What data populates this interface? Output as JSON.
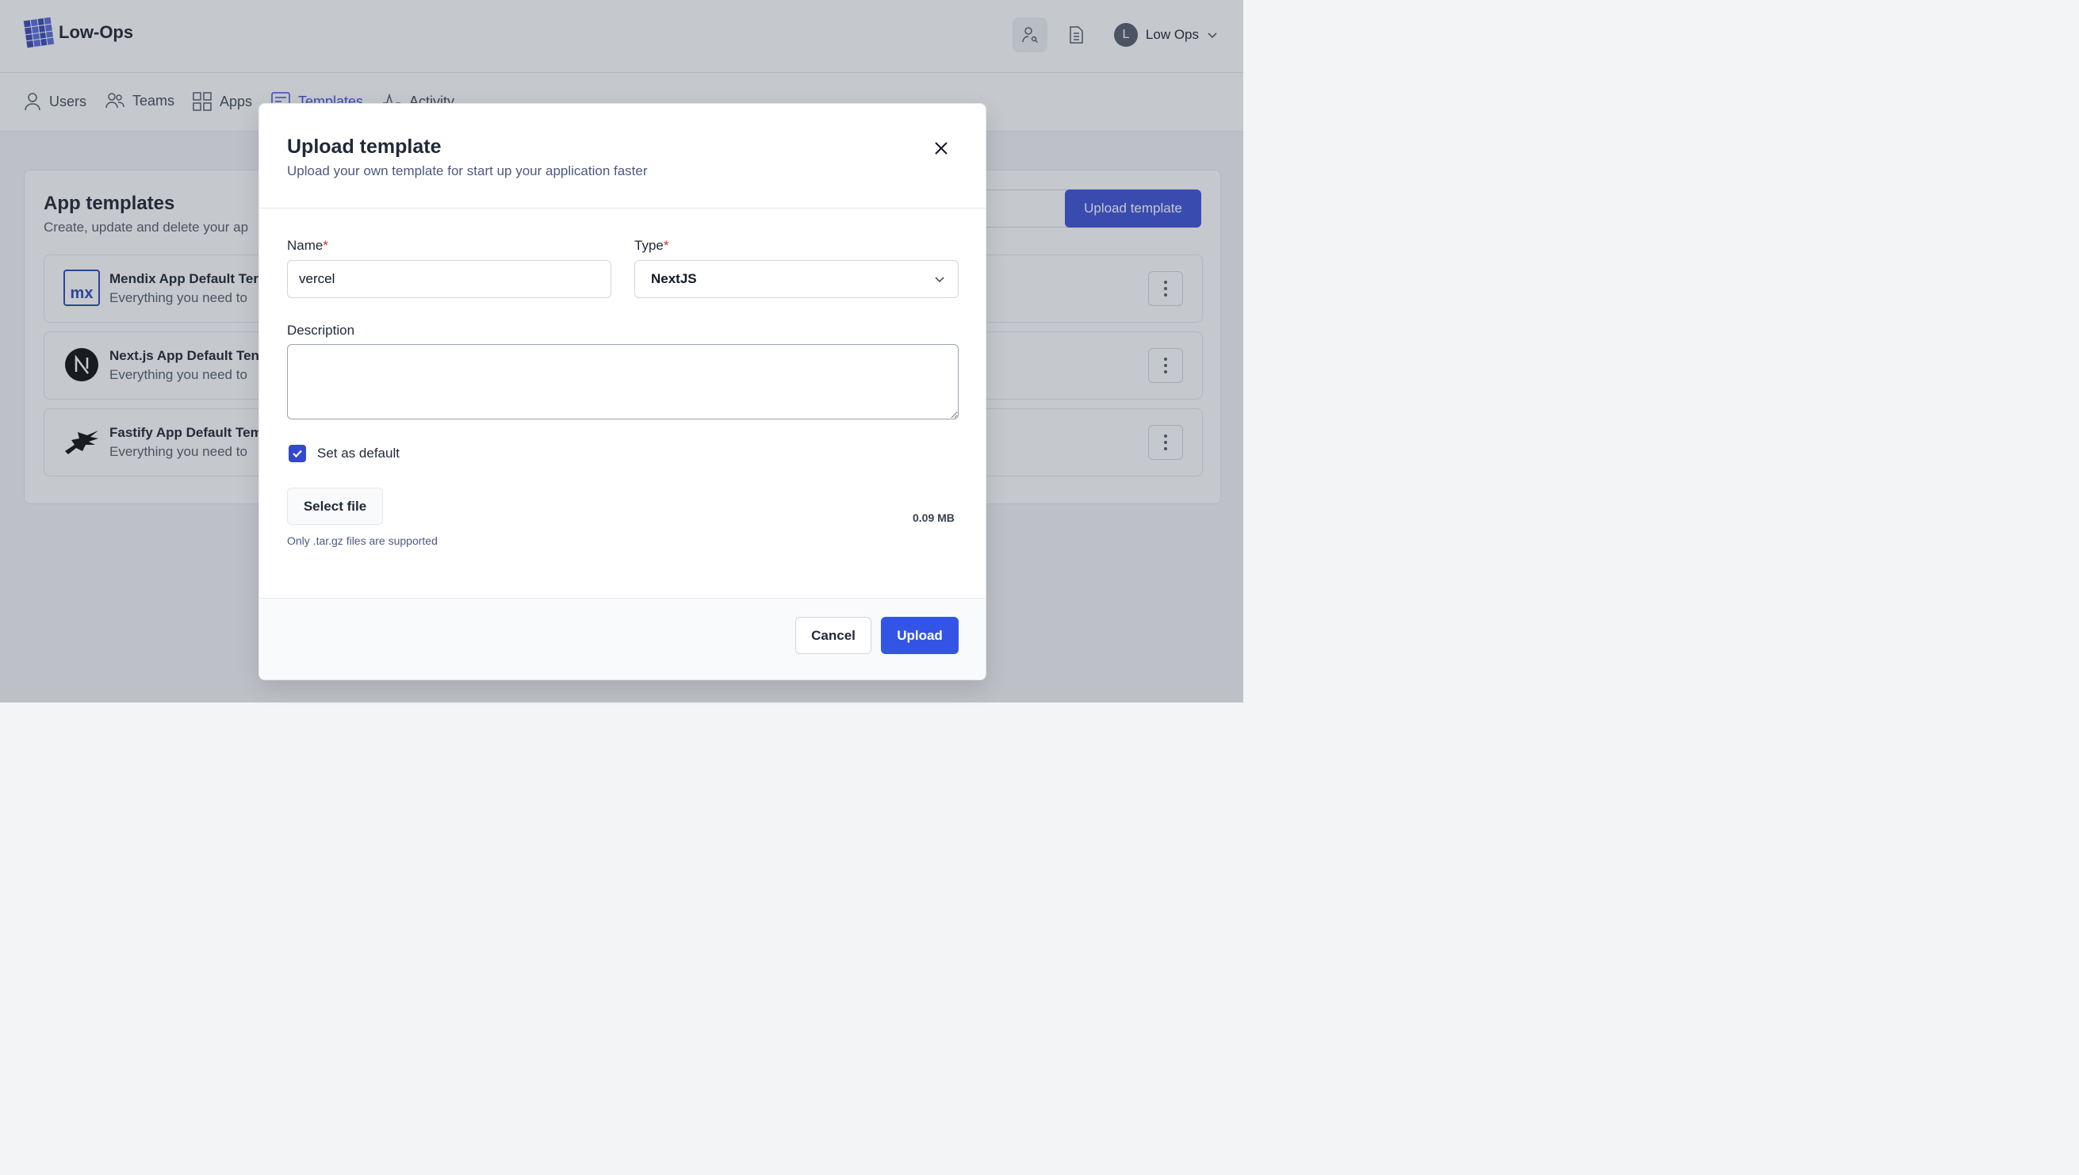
{
  "app": {
    "name": "Low-Ops"
  },
  "header": {
    "user_name": "Low Ops",
    "avatar_initial": "L",
    "icons": [
      "user-key-icon",
      "document-icon"
    ]
  },
  "nav": {
    "items": [
      {
        "label": "Users",
        "icon": "user-icon",
        "active": false
      },
      {
        "label": "Teams",
        "icon": "team-icon",
        "active": false
      },
      {
        "label": "Apps",
        "icon": "grid-icon",
        "active": false
      },
      {
        "label": "Templates",
        "icon": "template-icon",
        "active": true
      },
      {
        "label": "Activity",
        "icon": "activity-icon",
        "active": false
      }
    ]
  },
  "page": {
    "title": "App templates",
    "subtitle": "Create, update and delete your ap",
    "upload_button": "Upload template",
    "templates": [
      {
        "name": "Mendix App Default Ter",
        "description": "Everything you need to",
        "logo": "mendix-logo"
      },
      {
        "name": "Next.js App Default Ten",
        "description": "Everything you need to",
        "logo": "nextjs-logo"
      },
      {
        "name": "Fastify App Default Tem",
        "description": "Everything you need to",
        "logo": "fastify-logo"
      }
    ]
  },
  "modal": {
    "title": "Upload template",
    "subtitle": "Upload your own template for start up your application faster",
    "name_label": "Name",
    "name_value": "vercel",
    "type_label": "Type",
    "type_value": "NextJS",
    "required_mark": "*",
    "description_label": "Description",
    "description_value": "",
    "default_label": "Set as default",
    "default_checked": true,
    "select_file_label": "Select file",
    "file_size": "0.09 MB",
    "file_hint": "Only .tar.gz files are supported",
    "cancel_label": "Cancel",
    "submit_label": "Upload"
  },
  "colors": {
    "accent": "#3347d4",
    "required": "#dc2626",
    "overlay": "rgba(75,85,99,0.32)"
  }
}
